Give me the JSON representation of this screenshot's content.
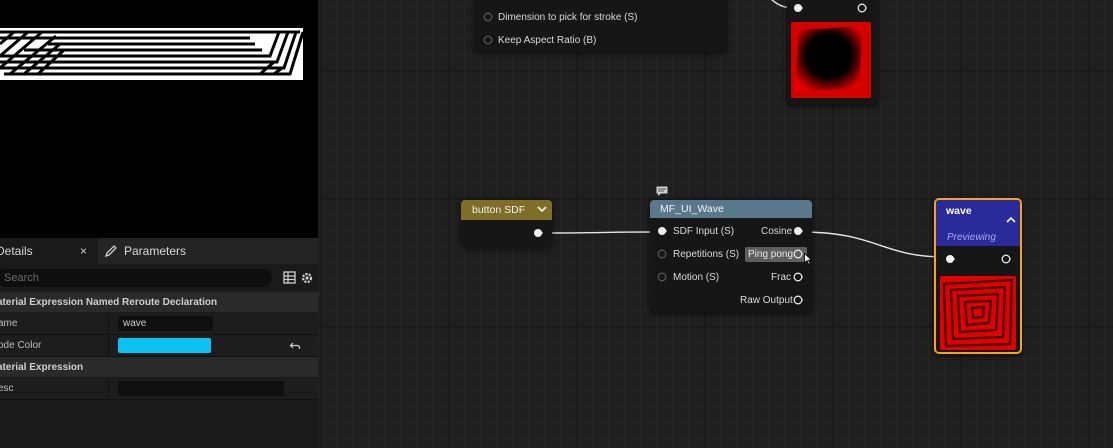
{
  "details_panel": {
    "tabs": {
      "details_label": "Details",
      "close_glyph": "×",
      "parameters_label": "Parameters"
    },
    "search": {
      "placeholder": "Search"
    },
    "sections": [
      {
        "title": "aterial Expression Named Reroute Declaration"
      },
      {
        "title": "aterial Expression"
      }
    ],
    "properties": {
      "name_label": "ame",
      "name_value": "wave",
      "node_color_label": "ode Color",
      "node_color_value": "#0bc2f2",
      "desc_label": "esc",
      "desc_value": ""
    }
  },
  "graph": {
    "top_node": {
      "pins": [
        "Dimension to pick for stroke (S)",
        "Keep Aspect Ratio (B)"
      ]
    },
    "button_sdf_node": {
      "title": "button SDF",
      "header_color": "#7e6e28"
    },
    "mf_node": {
      "title": "MF_UI_Wave",
      "header_color": "#5a788c",
      "inputs": [
        "SDF Input (S)",
        "Repetitions (S)",
        "Motion (S)"
      ],
      "outputs": [
        "Cosine",
        "Ping pong",
        "Frac",
        "Raw Output"
      ]
    },
    "wave_node": {
      "title": "wave",
      "status": "Previewing",
      "header_color": "#2a2a9a",
      "border_color": "#f2a516"
    },
    "preview_color": "#e00000"
  }
}
